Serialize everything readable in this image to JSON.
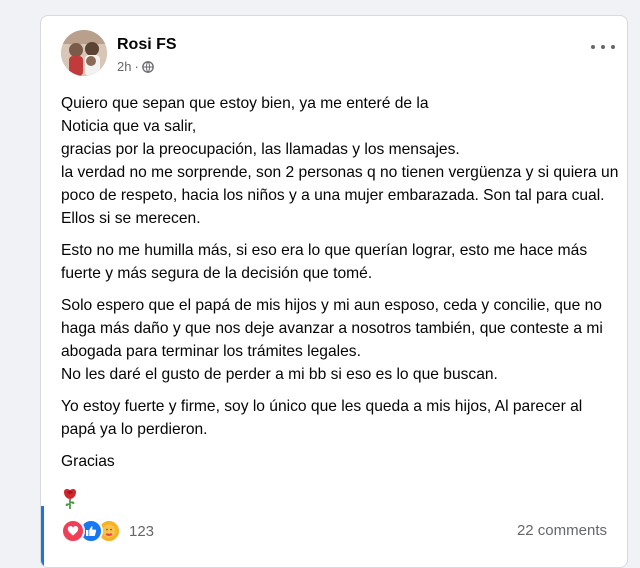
{
  "post": {
    "author": "Rosi FS",
    "time": "2h",
    "separator": "·",
    "privacy_icon": "globe-icon",
    "paragraphs": [
      "Quiero que sepan que estoy bien, ya me enteré de la\nNoticia que va salir,\ngracias por la preocupación, las llamadas y los mensajes.\nla verdad no me sorprende, son 2 personas q no tienen vergüenza y si quiera un poco de respeto, hacia los niños y a una mujer embarazada. Son tal para cual. Ellos si se merecen.",
      "Esto no me humilla más, si eso era lo que querían lograr, esto me hace más fuerte y más segura de la decisión que tomé.",
      "Solo espero que el papá de mis hijos y mi aun esposo, ceda y concilie, que no haga más daño y que nos deje avanzar a nosotros también, que conteste a mi abogada para terminar los trámites legales.\nNo les daré el gusto de perder a mi bb si eso es lo que buscan.",
      "Yo estoy fuerte y firme, soy lo único que les queda a mis hijos, Al parecer al papá ya lo perdieron.",
      "Gracias"
    ],
    "emoji": "rose-icon"
  },
  "footer": {
    "reaction_icons": [
      "love-icon",
      "like-icon",
      "care-icon"
    ],
    "reaction_count": "123",
    "comments": "22 comments"
  },
  "colors": {
    "accent": "#1b74e4",
    "love": "#f33e58",
    "like": "#1877f2",
    "care": "#f7b125",
    "secondary_text": "#65676b"
  }
}
